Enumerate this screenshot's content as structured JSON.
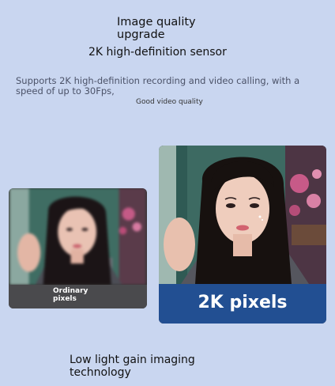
{
  "header": {
    "title_line1": "Image quality",
    "title_line2": "upgrade",
    "subtitle": "2K high-definition sensor"
  },
  "description": {
    "line1": "Supports 2K high-definition recording and video calling, with a",
    "line2": "speed of up to 30Fps,"
  },
  "quality_label": "Good video quality",
  "comparison": {
    "ordinary": {
      "line1": "Ordinary",
      "line2": "pixels"
    },
    "upgraded": {
      "label": "2K pixels"
    }
  },
  "footer": {
    "line1": "Low light gain imaging",
    "line2": "technology"
  },
  "colors": {
    "background": "#c9d6f0",
    "ordinary_caption_bg": "#4a4a4d",
    "upgraded_caption_bg": "#224f92"
  }
}
